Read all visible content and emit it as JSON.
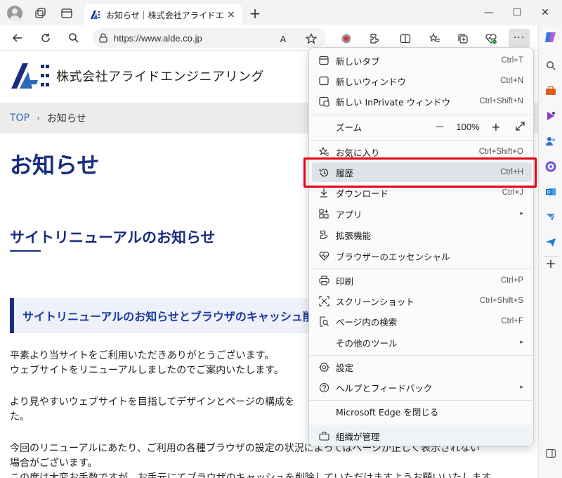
{
  "browser": {
    "tab_title": "お知らせ｜株式会社アライドエンジニアリング",
    "tab_close": "×",
    "new_tab": "+",
    "url": "https://www.alde.co.jp",
    "read_aloud_label": "A",
    "more_label": "···",
    "window": {
      "minimize": "—",
      "maximize": "☐",
      "close": "✕"
    }
  },
  "page": {
    "company_name": "株式会社アライドエンジニアリング",
    "breadcrumb": {
      "home": "TOP",
      "separator": "›",
      "current": "お知らせ"
    },
    "heading": "お知らせ",
    "subheading": "サイトリニューアルのお知らせ",
    "boxed_heading": "サイトリニューアルのお知らせとブラウザのキャッシュ削除のお願い",
    "paragraphs": [
      "平素より当サイトをご利用いただきありがとうございます。",
      "ウェブサイトをリニューアルしましたのでご案内いたします。",
      "より見やすいウェブサイトを目指してデザインとページの構成を",
      "た。",
      "今回のリニューアルにあたり、ご利用の各種ブラウザの設定の状況によってはページが正しく表示されない",
      "場合がございます。",
      "この度は大変お手数ですが、お手元にてブラウザのキャッシュを削除していただけますようお願いいたします。"
    ]
  },
  "menu": {
    "items": [
      {
        "label": "新しいタブ",
        "shortcut": "Ctrl+T"
      },
      {
        "label": "新しいウィンドウ",
        "shortcut": "Ctrl+N"
      },
      {
        "label": "新しい InPrivate ウィンドウ",
        "shortcut": "Ctrl+Shift+N"
      },
      {
        "label": "お気に入り",
        "shortcut": "Ctrl+Shift+O"
      },
      {
        "label": "履歴",
        "shortcut": "Ctrl+H"
      },
      {
        "label": "ダウンロード",
        "shortcut": "Ctrl+J"
      },
      {
        "label": "アプリ",
        "shortcut": ""
      },
      {
        "label": "拡張機能",
        "shortcut": ""
      },
      {
        "label": "ブラウザーのエッセンシャル",
        "shortcut": ""
      },
      {
        "label": "印刷",
        "shortcut": "Ctrl+P"
      },
      {
        "label": "スクリーンショット",
        "shortcut": "Ctrl+Shift+S"
      },
      {
        "label": "ページ内の検索",
        "shortcut": "Ctrl+F"
      },
      {
        "label": "その他のツール",
        "shortcut": ""
      },
      {
        "label": "設定",
        "shortcut": ""
      },
      {
        "label": "ヘルプとフィードバック",
        "shortcut": ""
      },
      {
        "label": "Microsoft Edge を閉じる",
        "shortcut": ""
      },
      {
        "label": "組織が管理",
        "shortcut": ""
      }
    ],
    "zoom": {
      "label": "ズーム",
      "minus": "—",
      "value": "100%",
      "plus": "+"
    },
    "submenu_arrow": "▸"
  },
  "colors": {
    "highlight": "#e60012",
    "brand_navy": "#1a2e80",
    "menu_hover": "#dde3e9"
  }
}
